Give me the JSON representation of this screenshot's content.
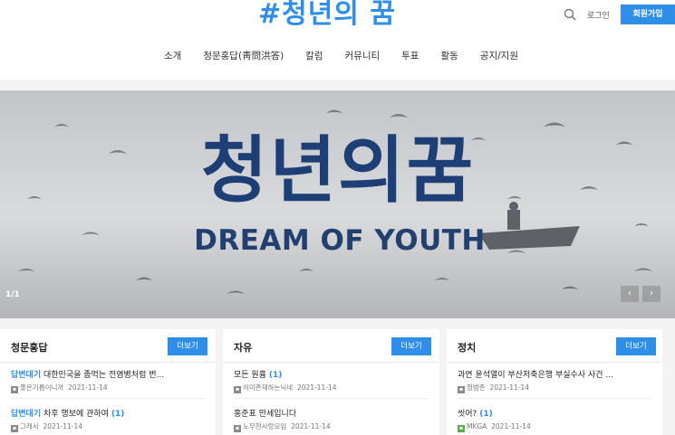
{
  "header": {
    "logo": "#청년의 꿈",
    "login_label": "로그인",
    "join_label": "회원가입"
  },
  "nav": {
    "items": [
      "소개",
      "청문홍답(靑問洪答)",
      "칼럼",
      "커뮤니티",
      "투표",
      "활동",
      "공지/지원"
    ]
  },
  "hero": {
    "title": "청년의꿈",
    "subtitle": "DREAM OF YOUTH",
    "counter": "1/1",
    "prev_label": "‹",
    "next_label": "›"
  },
  "boards": [
    {
      "title": "청문홍답",
      "more_label": "더보기",
      "posts": [
        {
          "tag": "답변대기",
          "title": "대한민국을 좀먹는 전염병처럼 번...",
          "count": "",
          "author": "좋은기름이니까",
          "date": "2021-11-14",
          "icon": "level-icon"
        },
        {
          "tag": "답변대기",
          "title": "차후 행보에 관하여",
          "count": "(1)",
          "author": "그래서",
          "date": "2021-11-14",
          "icon": "level-icon"
        }
      ]
    },
    {
      "title": "자유",
      "more_label": "더보기",
      "posts": [
        {
          "tag": "",
          "title": "모든 원흉",
          "count": "(1)",
          "author": "이미존재하는닉네",
          "date": "2021-11-14",
          "icon": "level-icon"
        },
        {
          "tag": "",
          "title": "홍준표 만세입니다",
          "count": "",
          "author": "노무현사랑모임",
          "date": "2021-11-14",
          "icon": "level-icon"
        }
      ]
    },
    {
      "title": "정치",
      "more_label": "더보기",
      "posts": [
        {
          "tag": "",
          "title": "과연 윤석열이 부산저축은행 부실수사 사건 ...",
          "count": "",
          "author": "정범준",
          "date": "2021-11-14",
          "icon": "level-icon"
        },
        {
          "tag": "",
          "title": "씻어?",
          "count": "(1)",
          "author": "MKGA",
          "date": "2021-11-14",
          "icon": "level-icon-green"
        }
      ]
    }
  ],
  "colors": {
    "accent": "#2f8ee8",
    "hero_text": "#1e3f75"
  }
}
